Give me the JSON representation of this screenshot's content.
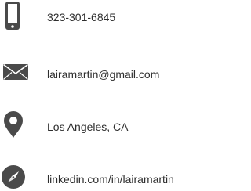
{
  "contacts": [
    {
      "icon": "phone-icon",
      "text": "323-301-6845"
    },
    {
      "icon": "mail-icon",
      "text": "lairamartin@gmail.com"
    },
    {
      "icon": "map-pin-icon",
      "text": "Los Angeles, CA"
    },
    {
      "icon": "compass-icon",
      "text": "linkedin.com/in/lairamartin"
    }
  ],
  "colors": {
    "icon": "#4a4a4a",
    "text": "#2e2e2e",
    "background": "#ffffff"
  }
}
